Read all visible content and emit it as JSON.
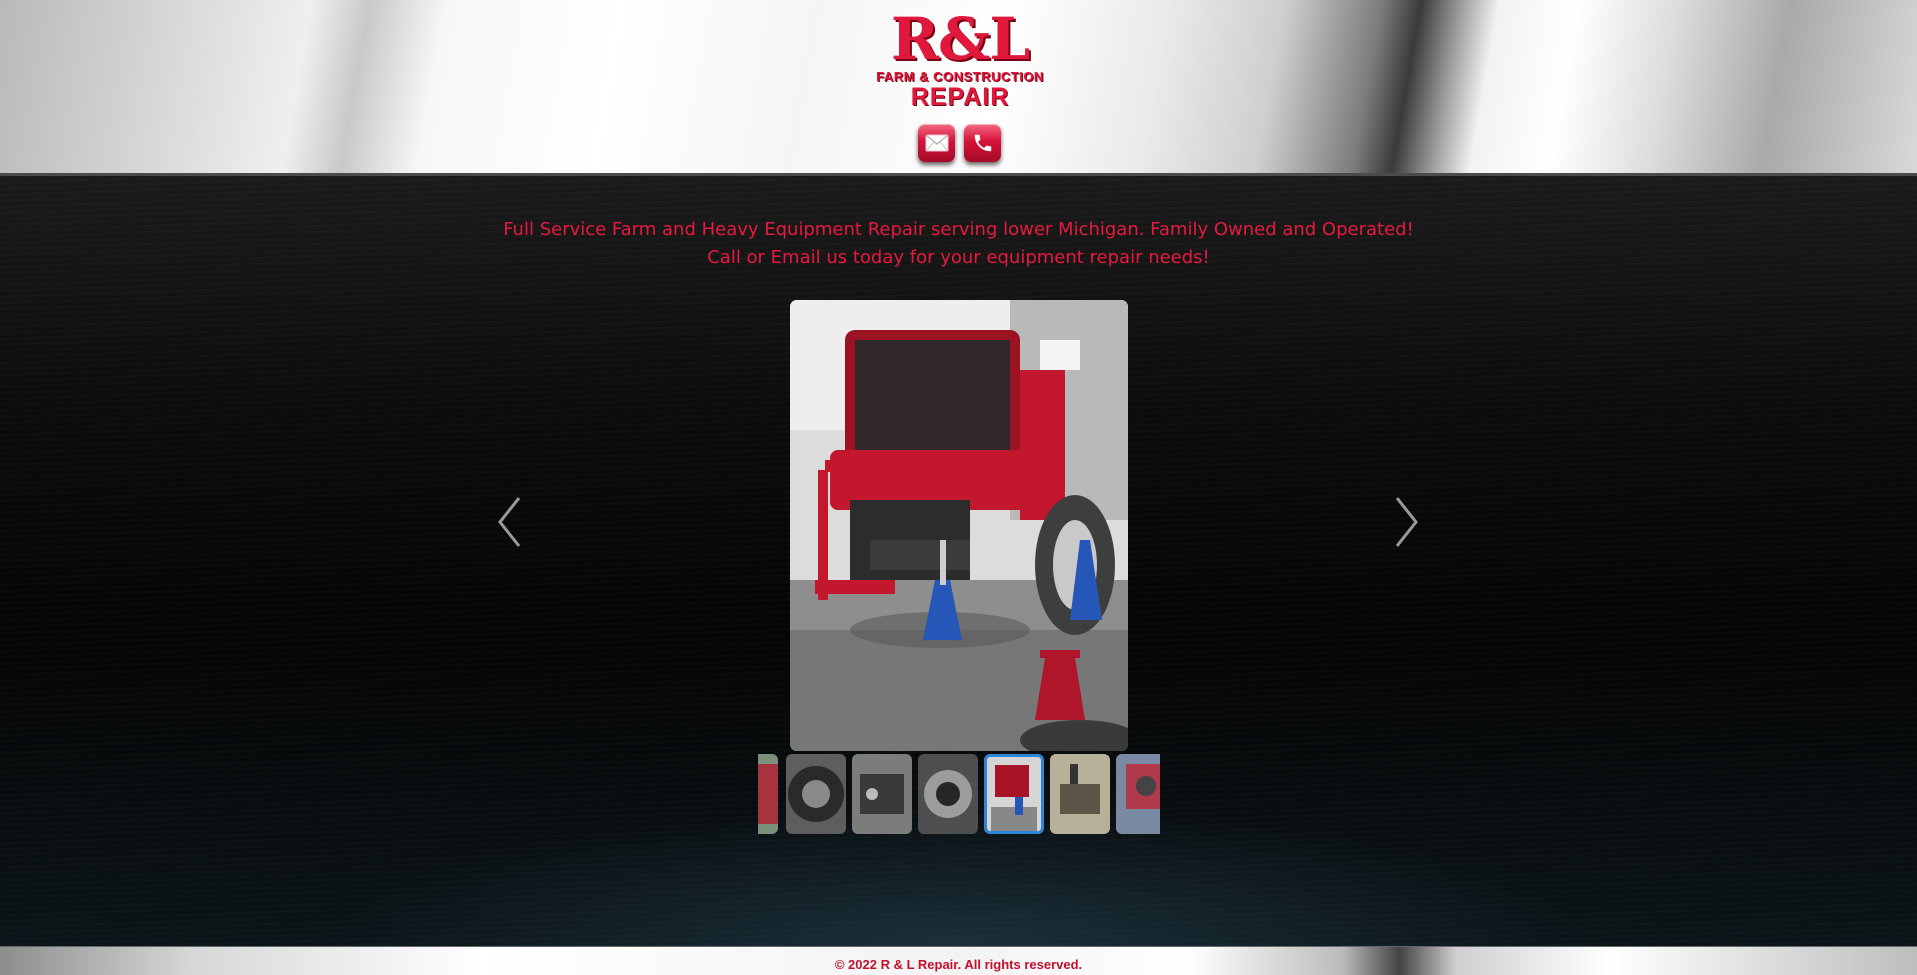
{
  "header": {
    "logo": {
      "title": "R&L",
      "subtitle": "FARM & CONSTRUCTION",
      "tagline": "REPAIR"
    },
    "email_icon": "envelope-icon",
    "phone_icon": "phone-icon"
  },
  "main": {
    "tagline_line1": "Full Service Farm and Heavy Equipment Repair serving lower Michigan. Family Owned and Operated!",
    "tagline_line2": "Call or Email us today for your equipment repair needs!",
    "slider": {
      "prev_icon": "chevron-left-icon",
      "next_icon": "chevron-right-icon",
      "active_index": 4,
      "thumb_count": 7
    }
  },
  "footer": {
    "copyright": "© 2022 R & L Repair. All rights reserved."
  },
  "colors": {
    "brand_red": "#e0183c",
    "active_border": "#2e86d6"
  }
}
